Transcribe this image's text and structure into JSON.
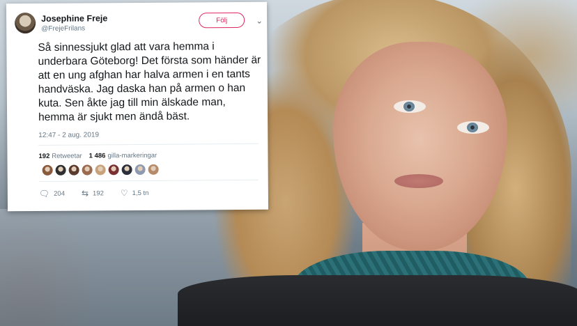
{
  "tweet": {
    "display_name": "Josephine Freje",
    "handle": "@FrejeFrilans",
    "follow_label": "Följ",
    "body": "Så sinnessjukt glad att vara hemma i underbara Göteborg! Det första som händer är att en ung afghan har halva armen i en tants handväska. Jag daska han på armen o han kuta. Sen åkte jag till min älskade man, hemma är sjukt men ändå bäst.",
    "timestamp": "12:47 - 2 aug. 2019",
    "retweets_count": "192",
    "retweets_label": "Retweetar",
    "likes_count": "1 486",
    "likes_label": "gilla-markeringar",
    "liker_avatars": [
      "#8a5a3c",
      "#2f2f2f",
      "#5a3b2e",
      "#9c6b4f",
      "#c7a27a",
      "#7a3030",
      "#2a2f3a",
      "#8e9ab0",
      "#b68b6a"
    ],
    "actions": {
      "reply_count": "204",
      "retweet_count": "192",
      "like_count": "1,5 tn"
    }
  },
  "icons": {
    "reply": "reply-icon",
    "retweet": "retweet-icon",
    "like": "heart-icon",
    "more": "chevron-down-icon"
  },
  "colors": {
    "follow_accent": "#e0245e",
    "text": "#14171a",
    "muted": "#657786"
  }
}
